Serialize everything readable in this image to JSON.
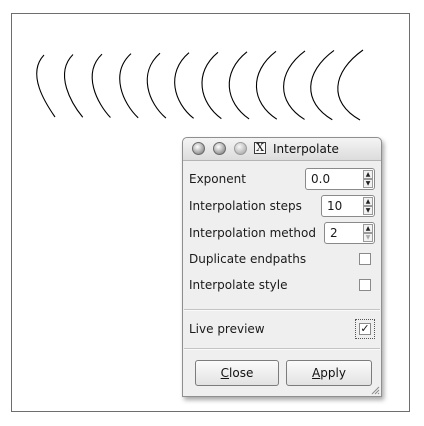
{
  "dialog": {
    "title": "Interpolate",
    "titlebar_x": "X",
    "fields": [
      {
        "label": "Exponent",
        "value": "0.0"
      },
      {
        "label": "Interpolation steps",
        "value": "10"
      },
      {
        "label": "Interpolation method",
        "value": "2"
      }
    ],
    "checkboxes": [
      {
        "label": "Duplicate endpaths",
        "checked": false
      },
      {
        "label": "Interpolate style",
        "checked": false
      }
    ],
    "live_preview": {
      "label": "Live preview",
      "checked": true,
      "check_glyph": "✓"
    },
    "buttons": {
      "close_mnemonic": "C",
      "close_rest": "lose",
      "apply_mnemonic": "A",
      "apply_rest": "pply"
    },
    "icons": [
      "close-window-icon",
      "minimize-window-icon",
      "maximize-window-icon",
      "x-app-icon",
      "resize-grip-icon",
      "spin-up-icon",
      "spin-down-icon",
      "checkmark-icon"
    ]
  },
  "canvas": {
    "curve_count": 12,
    "stroke_color": "#000000"
  },
  "colors": {
    "dialog_bg": "#efefef",
    "border": "#8f8f8f"
  }
}
